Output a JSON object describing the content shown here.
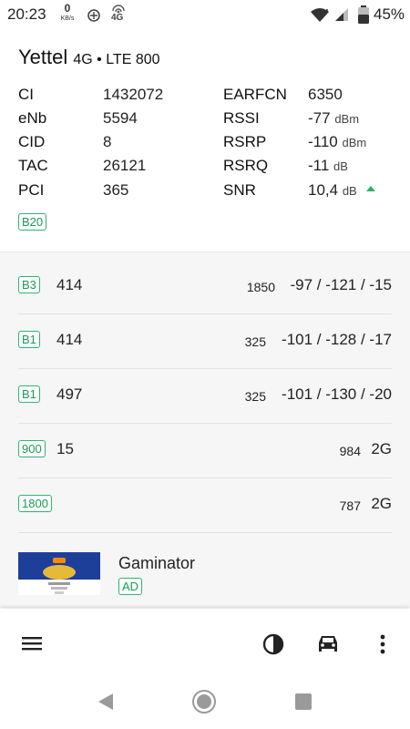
{
  "status_bar": {
    "time": "20:23",
    "speed_value": "0",
    "speed_unit": "KB/s",
    "network_badge": "4G",
    "battery_pct": "45%"
  },
  "header": {
    "carrier": "Yettel",
    "tech": "4G • LTE 800"
  },
  "cell_info": {
    "left": [
      {
        "label": "CI",
        "value": "1432072"
      },
      {
        "label": "eNb",
        "value": "5594"
      },
      {
        "label": "CID",
        "value": "8"
      },
      {
        "label": "TAC",
        "value": "26121"
      },
      {
        "label": "PCI",
        "value": "365"
      }
    ],
    "right": [
      {
        "label": "EARFCN",
        "value": "6350",
        "unit": ""
      },
      {
        "label": "RSSI",
        "value": "-77",
        "unit": "dBm"
      },
      {
        "label": "RSRP",
        "value": "-110",
        "unit": "dBm"
      },
      {
        "label": "RSRQ",
        "value": "-11",
        "unit": "dB"
      },
      {
        "label": "SNR",
        "value": "10,4",
        "unit": "dB"
      }
    ],
    "band": "B20"
  },
  "neighbors": [
    {
      "band": "B3",
      "pci": "414",
      "channel": "1850",
      "signal": "-97 / -121 / -15"
    },
    {
      "band": "B1",
      "pci": "414",
      "channel": "325",
      "signal": "-101 / -128 / -17"
    },
    {
      "band": "B1",
      "pci": "497",
      "channel": "325",
      "signal": "-101 / -130 / -20"
    },
    {
      "band": "900",
      "pci": "15",
      "channel": "984",
      "signal": "2G"
    },
    {
      "band": "1800",
      "pci": "",
      "channel": "787",
      "signal": "2G"
    }
  ],
  "ad": {
    "title": "Gaminator",
    "badge": "AD"
  },
  "colors": {
    "accent_green": "#2bb673",
    "list_bg": "#f5f6f5"
  },
  "icons": {
    "menu": "menu-icon",
    "theme": "contrast-icon",
    "car": "car-icon",
    "more": "more-vert-icon"
  }
}
